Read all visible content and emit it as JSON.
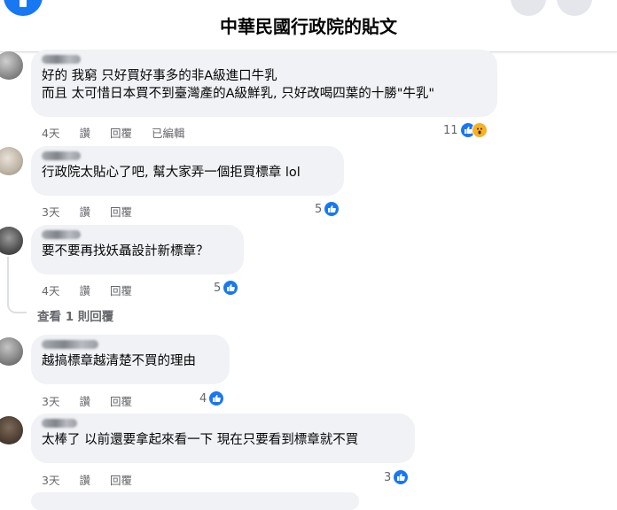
{
  "header": {
    "title": "中華民國行政院的貼文"
  },
  "comments": [
    {
      "lines": [
        "好的 我窮 只好買好事多的非A級進口牛乳",
        "而且 太可惜日本買不到臺灣產的A級鮮乳, 只好改喝四葉的十勝\"牛乳\""
      ],
      "time": "4天",
      "like": "讚",
      "reply": "回覆",
      "edited": "已編輯",
      "count": "11",
      "reactions": [
        "like-icon",
        "wow-icon"
      ]
    },
    {
      "lines": [
        "行政院太貼心了吧, 幫大家弄一個拒買標章 lol"
      ],
      "time": "3天",
      "like": "讚",
      "reply": "回覆",
      "count": "5",
      "reactions": [
        "like-icon"
      ]
    },
    {
      "lines": [
        "要不要再找妖聶設計新標章？"
      ],
      "time": "4天",
      "like": "讚",
      "reply": "回覆",
      "count": "5",
      "reactions": [
        "like-icon"
      ],
      "view_replies": "查看 1 則回覆"
    },
    {
      "lines": [
        "越搞標章越清楚不買的理由"
      ],
      "time": "3天",
      "like": "讚",
      "reply": "回覆",
      "count": "4",
      "reactions": [
        "like-icon"
      ]
    },
    {
      "lines": [
        "太棒了 以前還要拿起來看一下 現在只要看到標章就不買"
      ],
      "time": "3天",
      "like": "讚",
      "reply": "回覆",
      "count": "3",
      "reactions": [
        "like-icon"
      ]
    }
  ],
  "colors": {
    "accent": "#1877f2",
    "bubble": "#f0f2f5",
    "meta": "#65676b",
    "wow": "#f7b125"
  }
}
